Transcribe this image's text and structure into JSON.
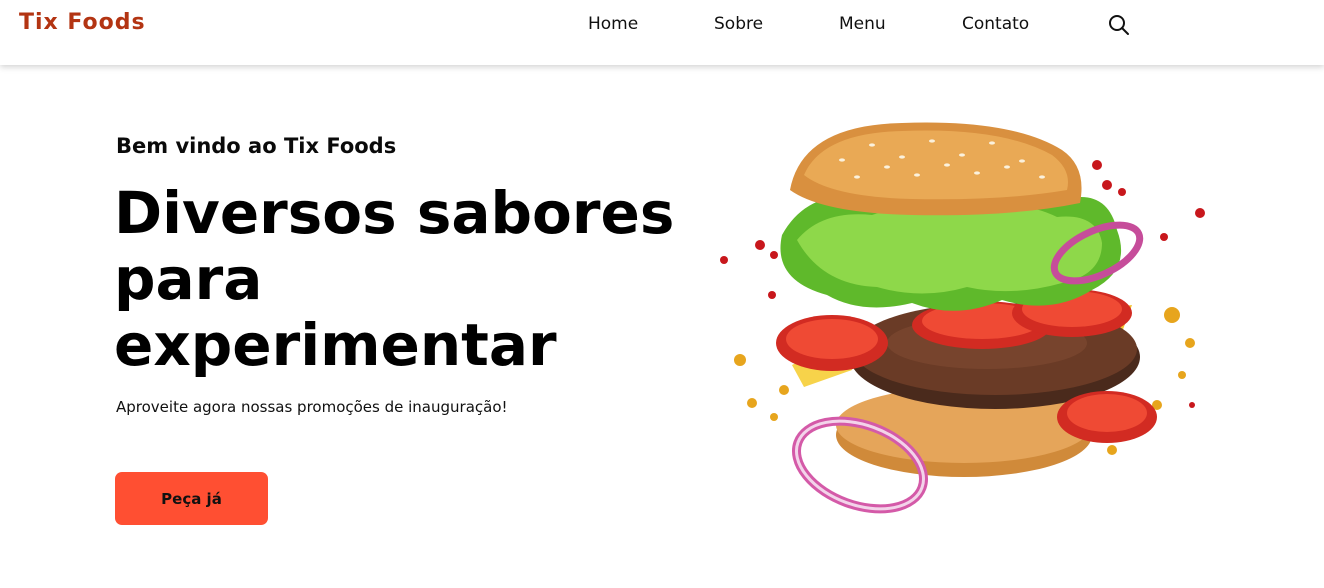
{
  "header": {
    "logo": "Tix Foods",
    "nav": [
      {
        "label": "Home"
      },
      {
        "label": "Sobre"
      },
      {
        "label": "Menu"
      },
      {
        "label": "Contato"
      }
    ],
    "search_icon": "search-icon"
  },
  "hero": {
    "subtitle": "Bem vindo ao Tix Foods",
    "title": "Diversos sabores para experimentar",
    "description": "Aproveite agora nossas promoções de inauguração!",
    "cta_label": "Peça já",
    "image": "burger-illustration"
  },
  "colors": {
    "brand": "#b33412",
    "cta": "#ff4f32",
    "text": "#000000",
    "background": "#ffffff"
  }
}
